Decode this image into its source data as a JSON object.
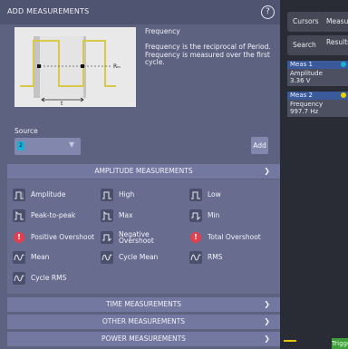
{
  "dialog": {
    "title": "ADD MEASUREMENTS",
    "help_icon": "?",
    "description_title": "Frequency",
    "description": "Frequency is the reciprocal of Period. Frequency is measured over the first cycle.",
    "preview": {
      "period_label": "t",
      "mid_label": "Rₘ"
    },
    "source_label": "Source",
    "source_value": "2",
    "source_color": "#1ab1d8",
    "add_label": "Add"
  },
  "categories": {
    "amplitude": "AMPLITUDE MEASUREMENTS",
    "time": "TIME MEASUREMENTS",
    "other": "OTHER MEASUREMENTS",
    "power": "POWER MEASUREMENTS",
    "chevron": "❯"
  },
  "amplitude_items": [
    {
      "label": "Amplitude",
      "icon": "amplitude-icon"
    },
    {
      "label": "High",
      "icon": "high-icon"
    },
    {
      "label": "Low",
      "icon": "low-icon"
    },
    {
      "label": "Peak-to-peak",
      "icon": "peak-to-peak-icon"
    },
    {
      "label": "Max",
      "icon": "max-icon"
    },
    {
      "label": "Min",
      "icon": "min-icon"
    },
    {
      "label": "Positive Overshoot",
      "icon": "positive-overshoot-icon"
    },
    {
      "label": "Negative Overshoot",
      "icon": "negative-overshoot-icon"
    },
    {
      "label": "Total Overshoot",
      "icon": "total-overshoot-icon"
    },
    {
      "label": "Mean",
      "icon": "mean-icon"
    },
    {
      "label": "Cycle Mean",
      "icon": "cycle-mean-icon"
    },
    {
      "label": "RMS",
      "icon": "rms-icon"
    },
    {
      "label": "Cycle RMS",
      "icon": "cycle-rms-icon"
    }
  ],
  "right_panel": {
    "cursors_label": "Cursors",
    "measure_label": "Measure",
    "search_label": "Search",
    "results_label": "Results Table",
    "meas1": {
      "title": "Meas 1",
      "name": "Amplitude",
      "value": "3.36 V",
      "color": "#1ab1d8"
    },
    "meas2": {
      "title": "Meas 2",
      "name": "Frequency",
      "value": "997.7 Hz",
      "color": "#e6d200"
    },
    "triggered_label": "Triggered"
  }
}
